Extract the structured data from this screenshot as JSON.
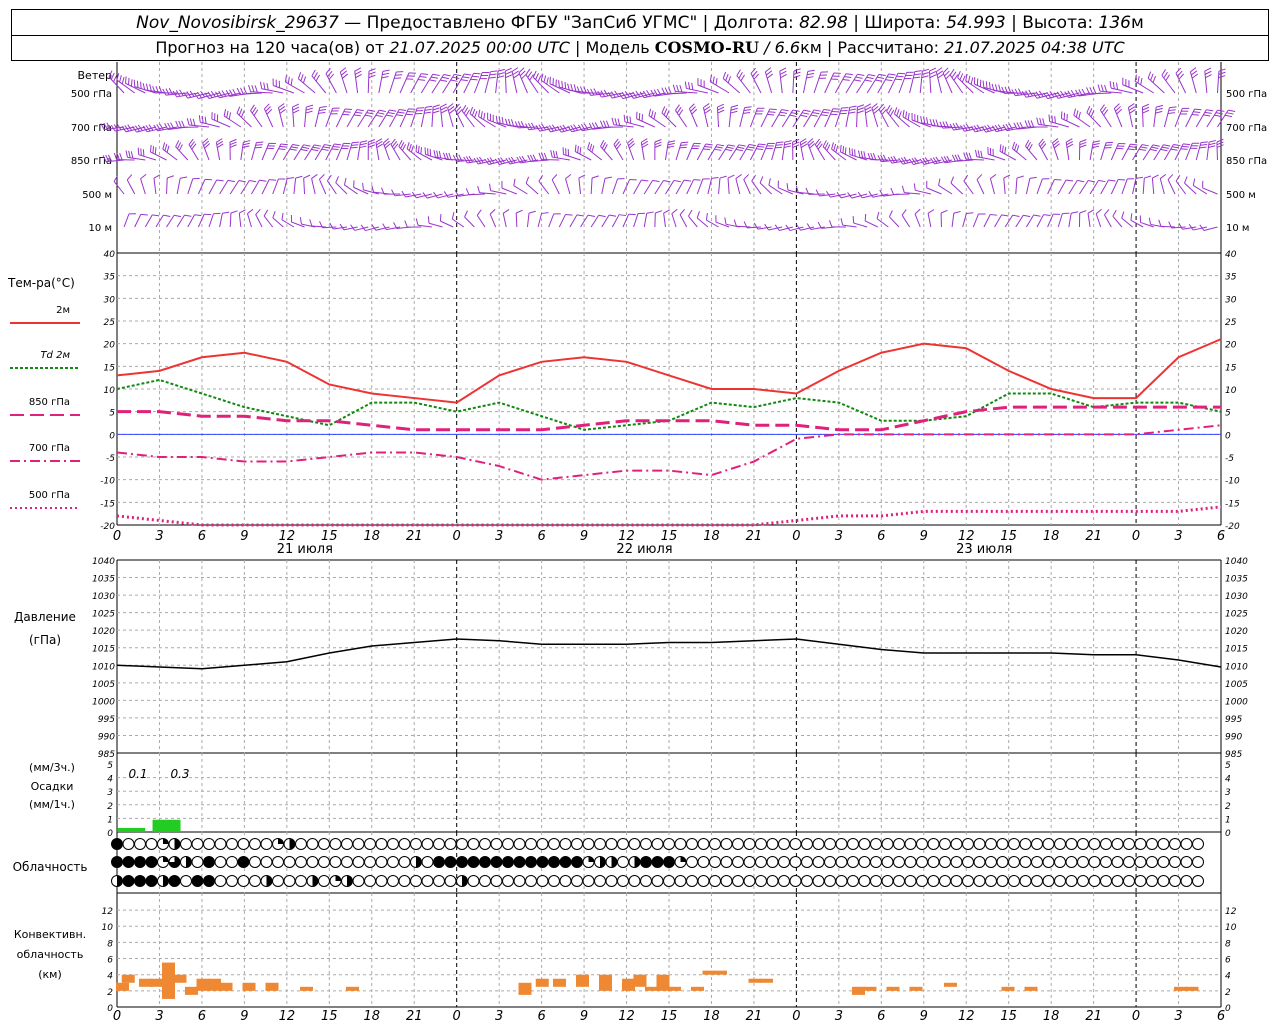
{
  "header": {
    "station": "Nov_Novosibirsk_29637",
    "provider": " — Предоставлено ФГБУ \"ЗапСиб УГМС\" | Долгота: ",
    "lon": "82.98",
    "lat_label": " | Широта: ",
    "lat": "54.993",
    "alt_label": " | Высота: ",
    "alt": "136",
    "alt_unit": "м",
    "forecast_label": "Прогноз на 120 часа(ов) от ",
    "forecast_start": "21.07.2025 00:00 UTC",
    "model_label": " | Модель ",
    "model": "COSMO-RU",
    "res": " / 6.6",
    "res_unit": "км | Рассчитано: ",
    "computed": "21.07.2025 04:38 UTC"
  },
  "labels": {
    "wind": "Ветер",
    "wind_levels": [
      "500 гПа",
      "700 гПа",
      "850 гПа",
      "500 м",
      "10 м"
    ],
    "temp_title": "Тем-ра(°C)",
    "temp_legend": [
      "2м",
      "Td 2м",
      "850 гПа",
      "700 гПа",
      "500 гПа"
    ],
    "pressure_title": "Давление",
    "pressure_unit": "(гПа)",
    "precip_1": "(мм/3ч.)",
    "precip_2": "Осадки",
    "precip_3": "(мм/1ч.)",
    "cloud_title": "Облачность",
    "conv_1": "Конвективн.",
    "conv_2": "облачность",
    "conv_3": "(км)",
    "days": [
      "21 июля",
      "22 июля",
      "23 июля"
    ],
    "precip_values": [
      "0.1",
      "0.3"
    ]
  },
  "colors": {
    "t2m": "#ee3333",
    "td2m": "#118811",
    "t850": "#e0207a",
    "t700": "#e0207a",
    "t500": "#e0207a",
    "pressure": "#000000",
    "wind": "#9933cc",
    "precip": "#22cc22",
    "convective": "#ee8833"
  },
  "chart_data": [
    {
      "type": "line",
      "title": "Тем-ра(°C)",
      "x_hours": [
        0,
        3,
        6,
        9,
        12,
        15,
        18,
        21,
        24,
        27,
        30,
        33,
        36,
        39,
        42,
        45,
        48,
        51,
        54,
        57,
        60,
        63,
        66,
        69,
        72,
        75,
        78
      ],
      "x_ticks": [
        "0",
        "3",
        "6",
        "9",
        "12",
        "15",
        "18",
        "21",
        "0",
        "3",
        "6",
        "9",
        "12",
        "15",
        "18",
        "21",
        "0",
        "3",
        "6",
        "9",
        "12",
        "15",
        "18",
        "21",
        "0",
        "3",
        "6"
      ],
      "ylim": [
        -20,
        40
      ],
      "yticks": [
        -20,
        -15,
        -10,
        -5,
        0,
        5,
        10,
        15,
        20,
        25,
        30,
        35,
        40
      ],
      "series": [
        {
          "name": "2м",
          "values": [
            13,
            14,
            17,
            18,
            16,
            11,
            9,
            8,
            7,
            13,
            16,
            17,
            16,
            13,
            10,
            10,
            9,
            14,
            18,
            20,
            19,
            14,
            10,
            8,
            8,
            17,
            21
          ]
        },
        {
          "name": "Td 2м",
          "values": [
            10,
            12,
            9,
            6,
            4,
            2,
            7,
            7,
            5,
            7,
            4,
            1,
            2,
            3,
            7,
            6,
            8,
            7,
            3,
            3,
            4,
            9,
            9,
            6,
            7,
            7,
            5
          ]
        },
        {
          "name": "850 гПа",
          "values": [
            5,
            5,
            4,
            4,
            3,
            3,
            2,
            1,
            1,
            1,
            1,
            2,
            3,
            3,
            3,
            2,
            2,
            1,
            1,
            3,
            5,
            6,
            6,
            6,
            6,
            6,
            6
          ]
        },
        {
          "name": "700 гПа",
          "values": [
            -4,
            -5,
            -5,
            -6,
            -6,
            -5,
            -4,
            -4,
            -5,
            -7,
            -10,
            -9,
            -8,
            -8,
            -9,
            -6,
            -1,
            0,
            0,
            0,
            0,
            0,
            0,
            0,
            0,
            1,
            2
          ]
        },
        {
          "name": "500 гПа",
          "values": [
            -18,
            -19,
            -21,
            -21,
            -21,
            -20,
            -20,
            -21,
            -21,
            -21,
            -21,
            -21,
            -21,
            -21,
            -21,
            -21,
            -19,
            -18,
            -18,
            -17,
            -17,
            -17,
            -17,
            -17,
            -17,
            -17,
            -16
          ]
        }
      ]
    },
    {
      "type": "line",
      "title": "Давление",
      "ylabel": "(гПа)",
      "ylim": [
        985,
        1040
      ],
      "yticks": [
        985,
        990,
        995,
        1000,
        1005,
        1010,
        1015,
        1020,
        1025,
        1030,
        1035,
        1040
      ],
      "series": [
        {
          "values": [
            1010,
            1009.5,
            1009,
            1010,
            1011,
            1013.5,
            1015.5,
            1016.5,
            1017.5,
            1017,
            1016,
            1016,
            1016,
            1016.5,
            1016.5,
            1017,
            1017.5,
            1016,
            1014.5,
            1013.5,
            1013.5,
            1013.5,
            1013.5,
            1013,
            1013,
            1011.5,
            1009.5
          ]
        }
      ]
    },
    {
      "type": "bar",
      "title": "Осадки",
      "ylim": [
        0,
        5
      ],
      "yticks": [
        0,
        1,
        2,
        3,
        4,
        5
      ],
      "values": [
        {
          "x": 1,
          "value": 0.1
        },
        {
          "x": 3.5,
          "value": 0.3
        }
      ]
    },
    {
      "type": "bar",
      "title": "Конвективн. облачность",
      "ylim": [
        0,
        13
      ],
      "yticks": [
        0,
        2,
        4,
        6,
        8,
        10,
        12
      ],
      "layers_km": [
        [
          0,
          2,
          3
        ],
        [
          0.5,
          3,
          4
        ],
        [
          2,
          2.5,
          3.5
        ],
        [
          3,
          2.5,
          3.5
        ],
        [
          4,
          1,
          5.5
        ],
        [
          5,
          3,
          4
        ],
        [
          6,
          1.5,
          2.5
        ],
        [
          7,
          2,
          3.5
        ],
        [
          8,
          2,
          3.5
        ],
        [
          9,
          2,
          3
        ],
        [
          11,
          2,
          3
        ],
        [
          13,
          2,
          3
        ],
        [
          16,
          2,
          2.5
        ],
        [
          20,
          2,
          2.5
        ],
        [
          35,
          1.5,
          3
        ],
        [
          36.5,
          2.5,
          3.5
        ],
        [
          38,
          2.5,
          3.5
        ],
        [
          40,
          2.5,
          4
        ],
        [
          42,
          2,
          4
        ],
        [
          44,
          2,
          3.5
        ],
        [
          45,
          2.5,
          4
        ],
        [
          46,
          2,
          2.5
        ],
        [
          47,
          2,
          4
        ],
        [
          48,
          2,
          2.5
        ],
        [
          50,
          2,
          2.5
        ],
        [
          51,
          4,
          4.5
        ],
        [
          52,
          4,
          4.5
        ],
        [
          55,
          3,
          3.5
        ],
        [
          56,
          3,
          3.5
        ],
        [
          64,
          1.5,
          2.5
        ],
        [
          65,
          2,
          2.5
        ],
        [
          67,
          2,
          2.5
        ],
        [
          69,
          2,
          2.5
        ],
        [
          72,
          2.5,
          3
        ],
        [
          77,
          2,
          2.5
        ],
        [
          79,
          2,
          2.5
        ],
        [
          92,
          2,
          2.5
        ],
        [
          93,
          2,
          2.5
        ]
      ]
    }
  ],
  "clouds": {
    "upper": [
      "f",
      "e",
      "e",
      "e",
      "q",
      "h",
      "e",
      "e",
      "e",
      "e",
      "e",
      "e",
      "e",
      "e",
      "q",
      "h",
      "e",
      "e",
      "e",
      "e",
      "e",
      "e",
      "e",
      "e",
      "e",
      "e",
      "e",
      "e",
      "e",
      "e",
      "e",
      "e",
      "e",
      "e",
      "e",
      "e",
      "e",
      "e",
      "e",
      "e",
      "e",
      "e",
      "e",
      "e",
      "e",
      "e",
      "e",
      "e",
      "e",
      "e",
      "e",
      "e",
      "e",
      "e",
      "e",
      "e",
      "e",
      "e",
      "e",
      "e",
      "e",
      "e",
      "e",
      "e",
      "e",
      "e",
      "e",
      "e",
      "e",
      "e",
      "e",
      "e",
      "e",
      "e",
      "e",
      "e",
      "e",
      "e",
      "e",
      "e",
      "e",
      "e",
      "e",
      "e",
      "e",
      "e",
      "e",
      "e",
      "e",
      "e",
      "e",
      "e",
      "e",
      "e",
      "e"
    ],
    "middle": [
      "f",
      "f",
      "f",
      "f",
      "q",
      "t",
      "h",
      "e",
      "f",
      "e",
      "e",
      "f",
      "e",
      "e",
      "e",
      "e",
      "e",
      "e",
      "e",
      "e",
      "e",
      "e",
      "e",
      "e",
      "e",
      "e",
      "h",
      "e",
      "f",
      "f",
      "f",
      "f",
      "f",
      "f",
      "f",
      "f",
      "f",
      "f",
      "f",
      "f",
      "f",
      "q",
      "h",
      "h",
      "e",
      "h",
      "f",
      "f",
      "f",
      "q",
      "e",
      "e",
      "e",
      "e",
      "e",
      "e",
      "e",
      "e",
      "e",
      "e",
      "e",
      "e",
      "e",
      "e",
      "e",
      "e",
      "e",
      "e",
      "e",
      "e",
      "e",
      "e",
      "e",
      "e",
      "e",
      "e",
      "e",
      "e",
      "e",
      "e",
      "e",
      "e",
      "e",
      "e",
      "e",
      "e",
      "e",
      "e",
      "e",
      "e",
      "e",
      "e",
      "e",
      "e",
      "e"
    ],
    "low": [
      "h",
      "f",
      "f",
      "f",
      "h",
      "f",
      "e",
      "f",
      "f",
      "e",
      "e",
      "e",
      "e",
      "h",
      "e",
      "e",
      "e",
      "h",
      "e",
      "q",
      "h",
      "e",
      "e",
      "e",
      "e",
      "e",
      "e",
      "e",
      "e",
      "e",
      "h",
      "e",
      "e",
      "e",
      "e",
      "e",
      "e",
      "e",
      "e",
      "e",
      "e",
      "e",
      "e",
      "e",
      "e",
      "e",
      "e",
      "e",
      "e",
      "e",
      "e",
      "e",
      "e",
      "e",
      "e",
      "e",
      "e",
      "e",
      "e",
      "e",
      "e",
      "e",
      "e",
      "e",
      "e",
      "e",
      "e",
      "e",
      "e",
      "e",
      "e",
      "e",
      "e",
      "e",
      "e",
      "e",
      "e",
      "e",
      "e",
      "e",
      "e",
      "e",
      "e",
      "e",
      "e",
      "e",
      "e",
      "e",
      "e",
      "e",
      "e",
      "e",
      "e",
      "e",
      "e"
    ]
  }
}
